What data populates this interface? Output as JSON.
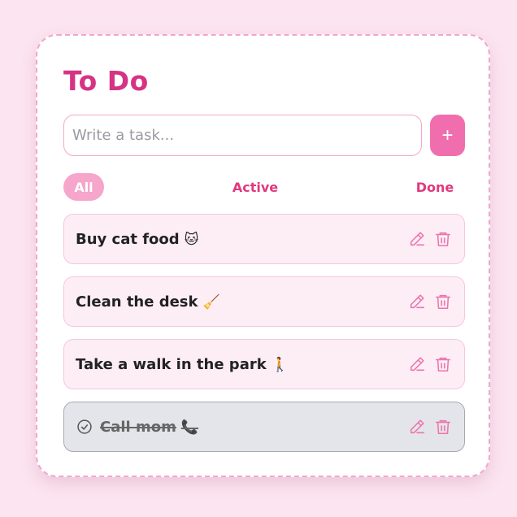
{
  "title": "To Do",
  "input": {
    "placeholder": "Write a task...",
    "value": ""
  },
  "add_button": {
    "label": "+",
    "icon": "plus-icon"
  },
  "filters": [
    {
      "label": "All",
      "selected": true
    },
    {
      "label": "Active",
      "selected": false
    },
    {
      "label": "Done",
      "selected": false
    }
  ],
  "tasks": [
    {
      "text": "Buy cat food",
      "emoji": "🐱",
      "done": false
    },
    {
      "text": "Clean the desk",
      "emoji": "🧹",
      "done": false
    },
    {
      "text": "Take a walk in the park",
      "emoji": "🚶",
      "done": false
    },
    {
      "text": "Call mom",
      "emoji": "📞",
      "done": true
    }
  ],
  "colors": {
    "accent": "#d63384",
    "button": "#f06eae",
    "filter_active_bg": "#f6a5cb",
    "task_bg": "#fdeef6",
    "task_done_bg": "#e4e5ea",
    "page_bg": "#fce4f0"
  },
  "icons": {
    "edit": "pencil-icon",
    "delete": "trash-icon",
    "completed": "check-circle-icon"
  }
}
